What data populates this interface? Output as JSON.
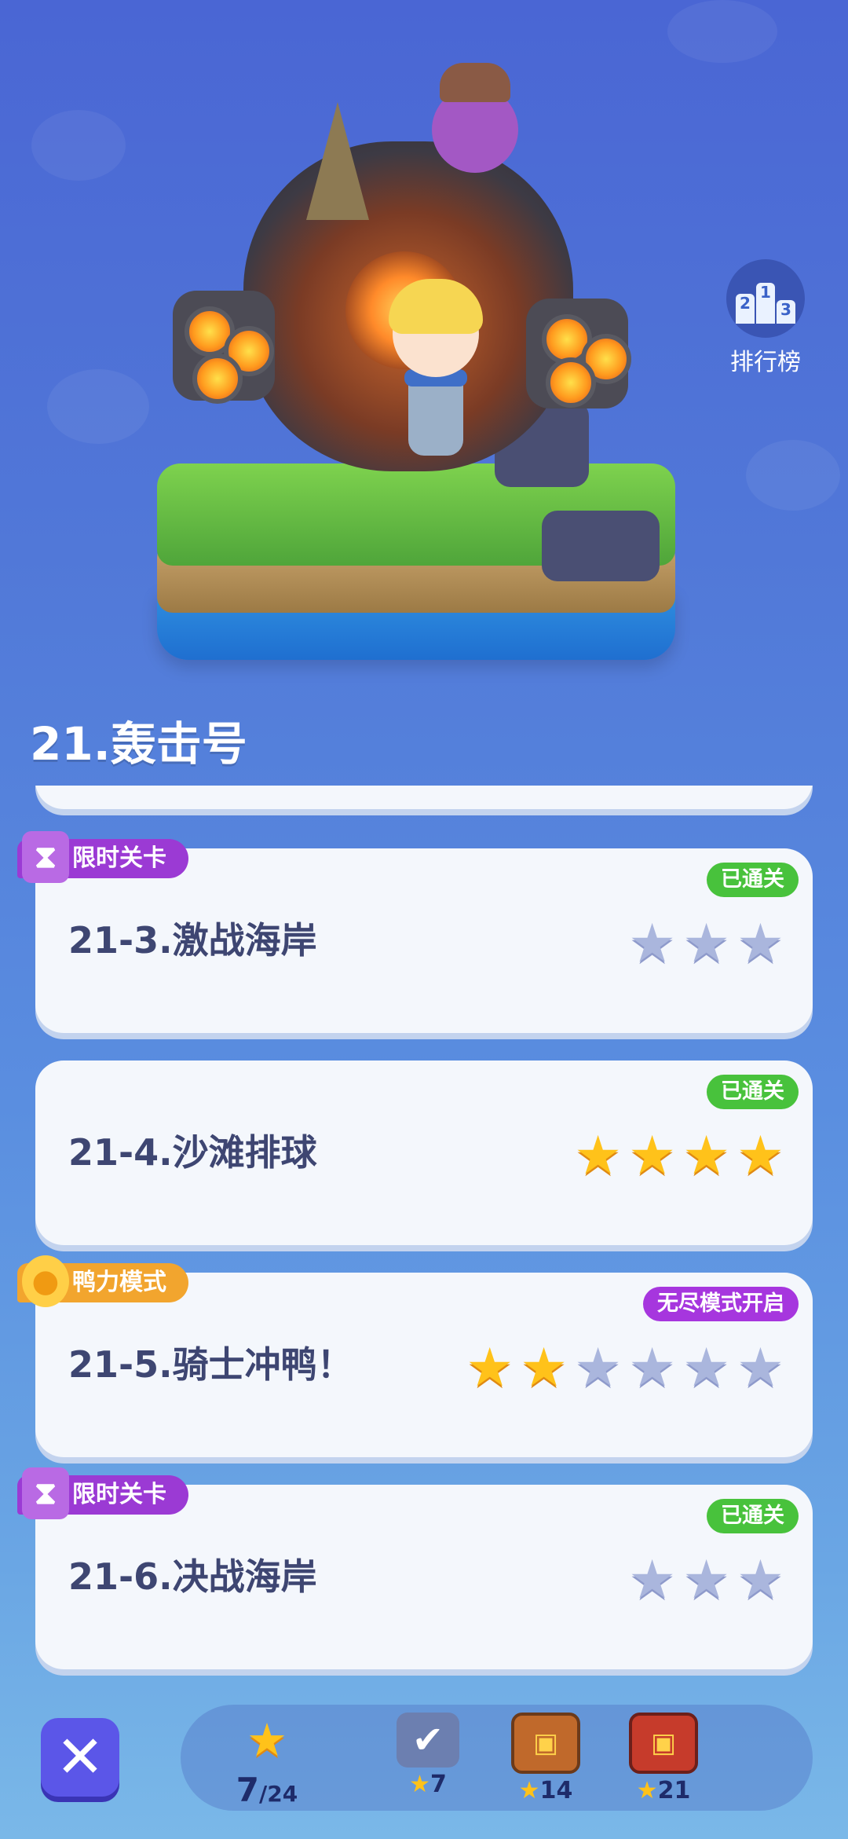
{
  "leaderboard": {
    "label": "排行榜",
    "podium": [
      "2",
      "1",
      "3"
    ]
  },
  "chapter": {
    "title": "21.轰击号"
  },
  "levels": [
    {
      "name": "21-3.激战海岸",
      "tag": "限时关卡",
      "status": "已通关",
      "stars_earned": 0,
      "stars_total": 3
    },
    {
      "name": "21-4.沙滩排球",
      "tag": "",
      "status": "已通关",
      "stars_earned": 4,
      "stars_total": 4
    },
    {
      "name": "21-5.骑士冲鸭！",
      "tag": "鸭力模式",
      "status": "无尽模式开启",
      "stars_earned": 2,
      "stars_total": 6
    },
    {
      "name": "21-6.决战海岸",
      "tag": "限时关卡",
      "status": "已通关",
      "stars_earned": 0,
      "stars_total": 3
    }
  ],
  "bottom_bar": {
    "progress": {
      "current": "7",
      "total": "/24"
    },
    "rewards": [
      {
        "icon": "check-reward-icon",
        "value": "7"
      },
      {
        "icon": "chest-icon",
        "value": "14"
      },
      {
        "icon": "chest-icon",
        "value": "21"
      }
    ]
  },
  "colors": {
    "status_green": "#48c23c",
    "status_purple": "#a636de",
    "star_on": "#ffc21a",
    "star_off": "#aab6dd",
    "close_button": "#5b56e8"
  }
}
